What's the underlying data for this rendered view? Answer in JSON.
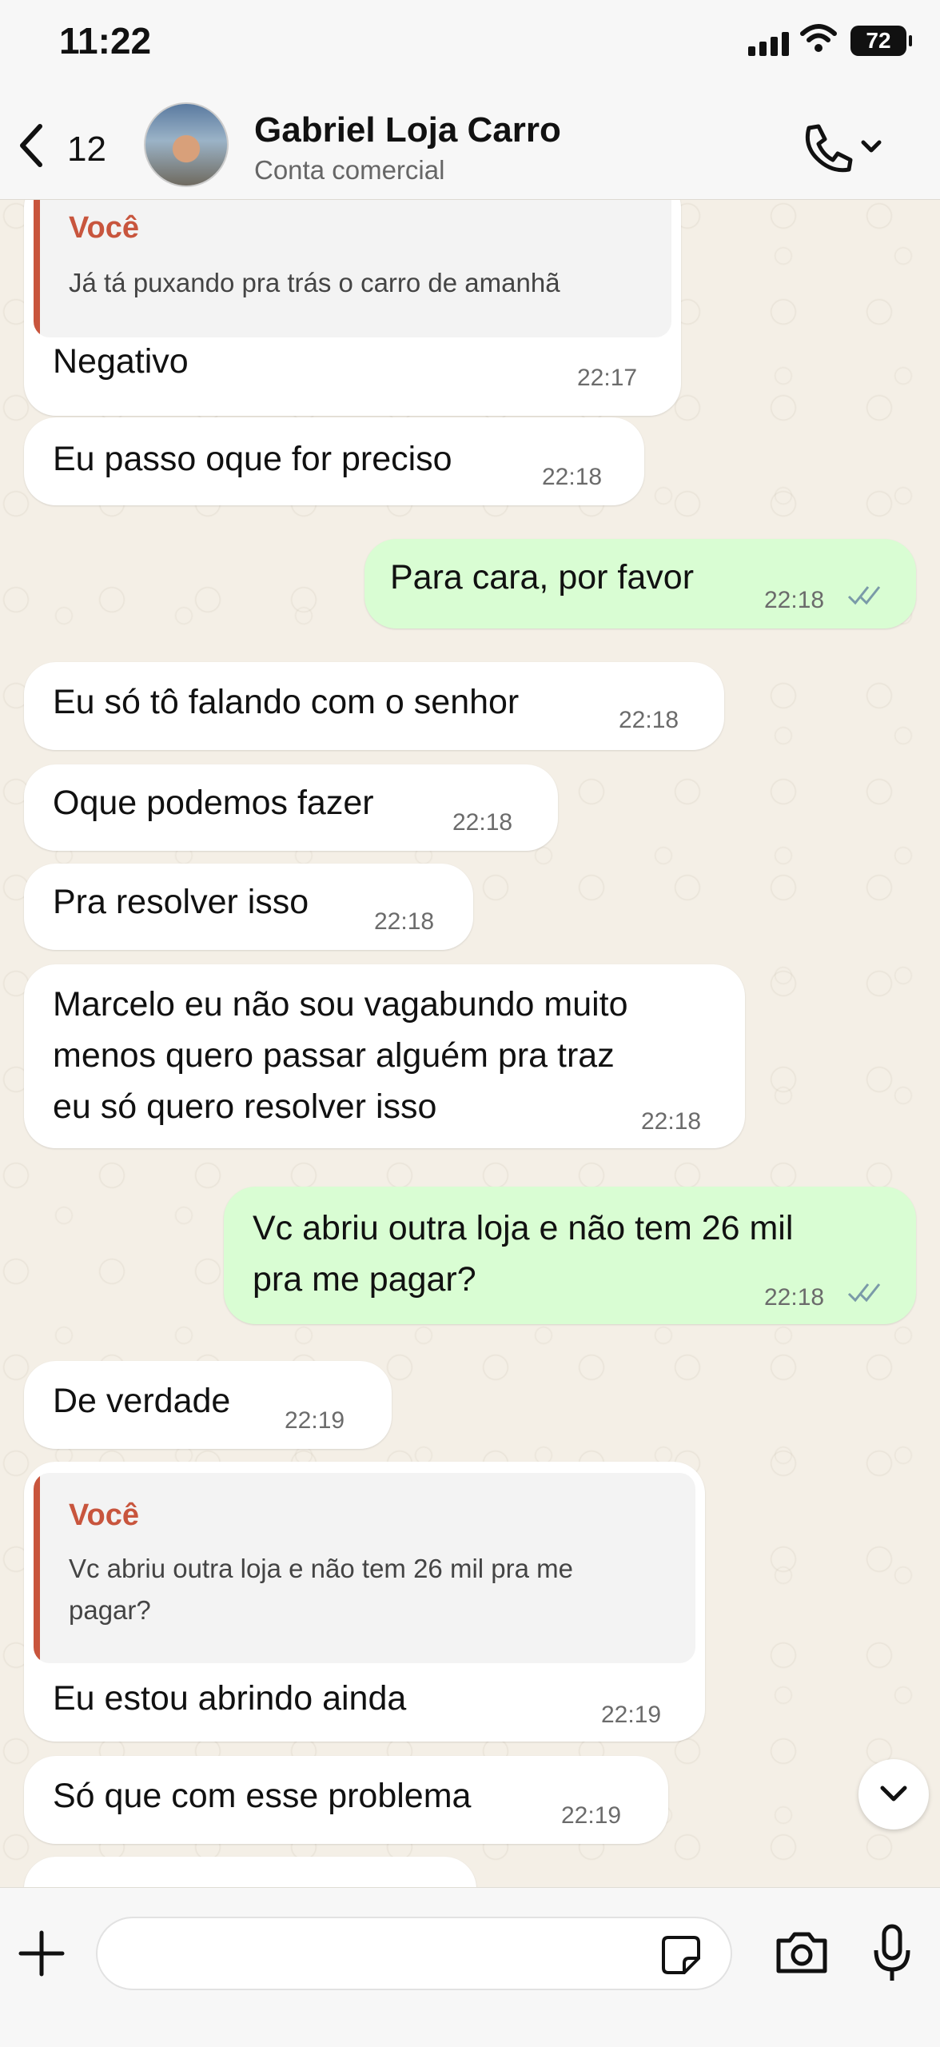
{
  "status": {
    "time": "11:22",
    "battery": "72"
  },
  "header": {
    "back_count": "12",
    "name": "Gabriel Loja Carro",
    "subtitle": "Conta comercial"
  },
  "messages": [
    {
      "dir": "in",
      "quote_author": "Você",
      "quote_text": "Já tá puxando pra trás o carro de amanhã",
      "text": "Negativo",
      "time": "22:17"
    },
    {
      "dir": "in",
      "text": "Eu passo oque for preciso",
      "time": "22:18"
    },
    {
      "dir": "out",
      "text": "Para cara, por favor",
      "time": "22:18"
    },
    {
      "dir": "in",
      "text": "Eu só tô falando com o senhor",
      "time": "22:18"
    },
    {
      "dir": "in",
      "text": "Oque podemos fazer",
      "time": "22:18"
    },
    {
      "dir": "in",
      "text": "Pra resolver isso",
      "time": "22:18"
    },
    {
      "dir": "in",
      "lines": [
        "Marcelo eu não sou vagabundo muito",
        "menos quero passar alguém pra traz",
        "eu só quero resolver isso"
      ],
      "time": "22:18"
    },
    {
      "dir": "out",
      "lines": [
        "Vc abriu outra loja e não tem 26 mil",
        "pra me pagar?"
      ],
      "time": "22:18"
    },
    {
      "dir": "in",
      "text": "De verdade",
      "time": "22:19"
    },
    {
      "dir": "in",
      "quote_author": "Você",
      "quote_lines": [
        "Vc abriu outra loja e não tem 26 mil pra me",
        "pagar?"
      ],
      "text": "Eu estou abrindo ainda",
      "time": "22:19"
    },
    {
      "dir": "in",
      "text": "Só que com esse problema",
      "time": "22:19"
    }
  ],
  "composer": {
    "placeholder": ""
  },
  "colors": {
    "outgoing": "#d9fdd3",
    "incoming": "#ffffff",
    "quote_accent": "#c8553d",
    "read_ticks": "#7a9aa8"
  },
  "icons": [
    "back-chevron-icon",
    "phone-icon",
    "chevron-down-icon",
    "plus-icon",
    "sticker-icon",
    "camera-icon",
    "mic-icon"
  ]
}
